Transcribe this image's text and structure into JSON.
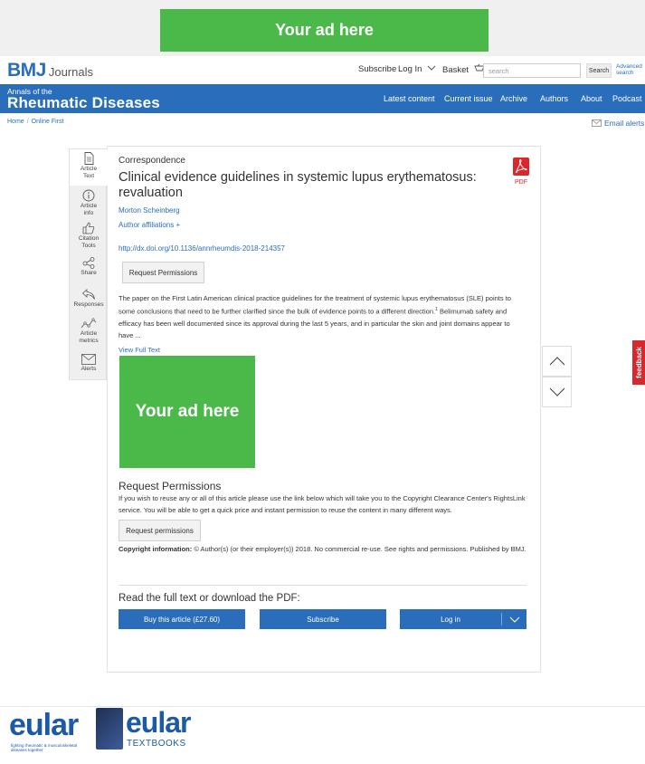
{
  "ads": {
    "top_banner": "Your ad here",
    "sidebar_square": "Your ad here"
  },
  "header": {
    "logo_brand": "BMJ",
    "logo_suffix": "Journals",
    "subscribe": "Subscribe",
    "login": "Log In",
    "basket": "Basket",
    "search_placeholder": "search",
    "search_button": "Search",
    "advanced_search_1": "Advanced",
    "advanced_search_2": "search"
  },
  "nav": {
    "journal_prefix": "Annals of the",
    "journal_name": "Rheumatic Diseases",
    "items": [
      "Latest content",
      "Current issue",
      "Archive",
      "Authors",
      "About",
      "Podcast"
    ]
  },
  "breadcrumb": [
    "Home",
    "Online First"
  ],
  "email_alerts": "Email alerts",
  "tools": [
    {
      "label_1": "Article",
      "label_2": "Text",
      "icon": "document-icon"
    },
    {
      "label_1": "Article",
      "label_2": "info",
      "icon": "info-icon"
    },
    {
      "label_1": "Citation",
      "label_2": "Tools",
      "icon": "thumbs-up-icon"
    },
    {
      "label_1": "Share",
      "label_2": "",
      "icon": "share-icon"
    },
    {
      "label_1": "Responses",
      "label_2": "",
      "icon": "reply-icon"
    },
    {
      "label_1": "Article",
      "label_2": "metrics",
      "icon": "metrics-icon"
    },
    {
      "label_1": "Alerts",
      "label_2": "",
      "icon": "envelope-icon"
    }
  ],
  "article": {
    "type": "Correspondence",
    "title": "Clinical evidence guidelines in systemic lupus erythematosus: revaluation",
    "author": "Morton Scheinberg",
    "affiliations": "Author affiliations +",
    "doi": "http://dx.doi.org/10.1136/annrheumdis-2018-214357",
    "request_permissions_button": "Request Permissions",
    "pdf_label": "PDF",
    "abstract_part1": "The paper on the First Latin American clinical practice guidelines for the treatment of systemic lupus erythematosus (SLE) points to some conclusions that need to be further clarified since the bulk of evidence points to a different direction.",
    "abstract_sup": "1",
    "abstract_part2": " Belimumab safety and efficacy has been well documented since its approval during the last 5 years, and in particular the skin and joint domains appear to have ...",
    "view_full_text": "View Full Text"
  },
  "request_permissions": {
    "heading": "Request Permissions",
    "text": "If you wish to reuse any or all of this article please use the link below which will take you to the Copyright Clearance Center's RightsLink service. You will be able to get a quick price and instant permission to reuse the content in many different ways.",
    "button": "Request permissions",
    "copyright_label": "Copyright information:",
    "copyright_text": " © Author(s) (or their employer(s)) 2018. No commercial re-use. See rights and permissions. Published by BMJ."
  },
  "purchase": {
    "heading": "Read the full text or download the PDF:",
    "buy": "Buy this article (£27.60)",
    "subscribe": "Subscribe",
    "login": "Log in"
  },
  "feedback": "feedback",
  "footer": {
    "eular": "eular",
    "eular_tagline": "fighting rheumatic & musculoskeletal diseases together",
    "eular_textbooks_brand": "eular",
    "eular_textbooks_sub": "TEXTBOOKS"
  },
  "colors": {
    "brand_blue": "#2a6ebb",
    "ad_green": "#4ab94a",
    "feedback_red": "#d9272e"
  }
}
